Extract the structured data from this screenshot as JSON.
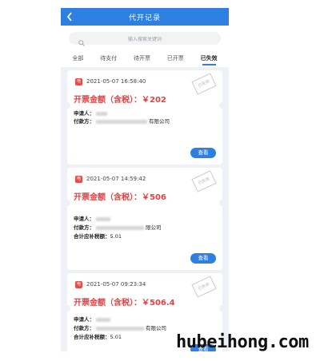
{
  "header": {
    "title": "代开记录",
    "back_icon": "back-arrow-icon"
  },
  "search": {
    "placeholder": "输入搜索关键词",
    "icon": "search-icon"
  },
  "tabs": [
    {
      "label": "全部",
      "active": false
    },
    {
      "label": "待支付",
      "active": false
    },
    {
      "label": "待开票",
      "active": false
    },
    {
      "label": "已开票",
      "active": false
    },
    {
      "label": "已失效",
      "active": true
    }
  ],
  "colors": {
    "primary": "#2d7fe0",
    "amount": "#e93f3f",
    "badge": "#e94b4b"
  },
  "records": [
    {
      "badge": "电",
      "time": "2021-05-07 16:58:40",
      "stamp": "已失效",
      "amount": "开票金额（含税）：￥202",
      "applicant_label": "申请人：",
      "payer_label": "付款方：",
      "payer_suffix": "有限公司",
      "tax_label": "",
      "tax_value": "",
      "button": "查看"
    },
    {
      "badge": "电",
      "time": "2021-05-07 14:59:42",
      "stamp": "已失效",
      "amount": "开票金额（含税）：￥506",
      "applicant_label": "申请人：",
      "payer_label": "付款方：",
      "payer_suffix": "限公司",
      "tax_label": "合计应补税额：",
      "tax_value": "5.01",
      "button": "查看"
    },
    {
      "badge": "电",
      "time": "2021-05-07 09:23:34",
      "stamp": "已失效",
      "amount": "开票金额（含税）：￥506.4",
      "applicant_label": "申请人：",
      "payer_label": "付款方：",
      "payer_suffix": "有限公司",
      "tax_label": "合计应补税额：",
      "tax_value": "5.01",
      "button": "查看"
    }
  ],
  "watermark": "hubeihong.com"
}
